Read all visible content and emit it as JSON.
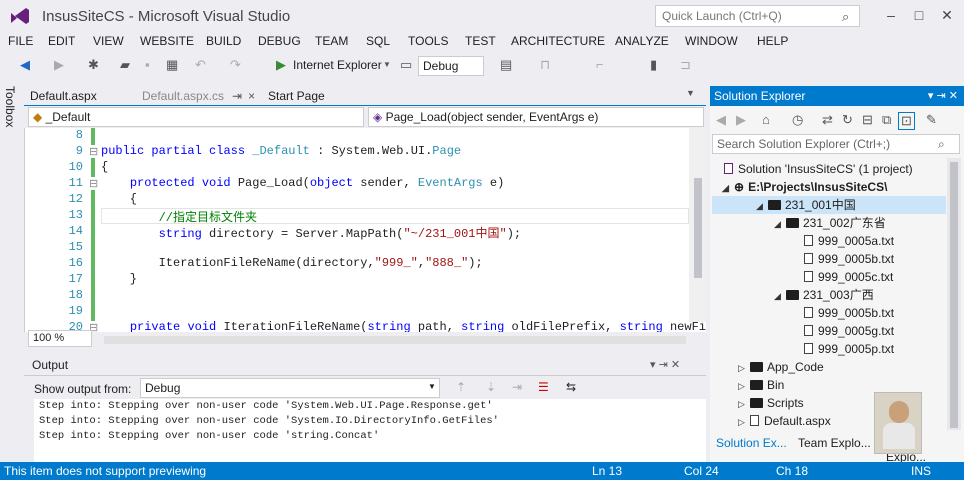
{
  "window": {
    "title": "InsusSiteCS - Microsoft Visual Studio",
    "quick_launch_placeholder": "Quick Launch (Ctrl+Q)"
  },
  "menu": [
    "FILE",
    "EDIT",
    "VIEW",
    "WEBSITE",
    "BUILD",
    "DEBUG",
    "TEAM",
    "SQL",
    "TOOLS",
    "TEST",
    "ARCHITECTURE",
    "ANALYZE",
    "WINDOW",
    "HELP"
  ],
  "toolbar": {
    "run_target": "Internet Explorer",
    "configuration": "Debug"
  },
  "side_tab": "Toolbox",
  "tabs": [
    {
      "label": "Default.aspx",
      "active": false
    },
    {
      "label": "Default.aspx.cs",
      "active": true
    },
    {
      "label": "Start Page",
      "active": false
    }
  ],
  "nav": {
    "class_combo": "_Default",
    "method_combo": "Page_Load(object sender, EventArgs e)"
  },
  "editor": {
    "zoom": "100 %",
    "lines": [
      {
        "n": "8",
        "t": ""
      },
      {
        "n": "9",
        "t": "public partial class _Default : System.Web.UI.Page"
      },
      {
        "n": "10",
        "t": "{"
      },
      {
        "n": "11",
        "t": "    protected void Page_Load(object sender, EventArgs e)"
      },
      {
        "n": "12",
        "t": "    {"
      },
      {
        "n": "13",
        "t": "        //指定目标文件夹"
      },
      {
        "n": "14",
        "t": "        string directory = Server.MapPath(\"~/231_001中国\");"
      },
      {
        "n": "15",
        "t": ""
      },
      {
        "n": "16",
        "t": "        IterationFileReName(directory,\"999_\",\"888_\");"
      },
      {
        "n": "17",
        "t": "    }"
      },
      {
        "n": "18",
        "t": ""
      },
      {
        "n": "19",
        "t": ""
      },
      {
        "n": "20",
        "t": "    private void IterationFileReName(string path, string oldFilePrefix, string newFi"
      }
    ]
  },
  "output": {
    "title": "Output",
    "show_from_label": "Show output from:",
    "show_from_value": "Debug",
    "lines": [
      "Step into: Stepping over non-user code 'System.Web.UI.Page.Response.get'",
      "Step into: Stepping over non-user code 'System.IO.DirectoryInfo.GetFiles'",
      "Step into: Stepping over non-user code 'string.Concat'"
    ]
  },
  "solution_explorer": {
    "title": "Solution Explorer",
    "search_placeholder": "Search Solution Explorer (Ctrl+;)",
    "solution": "Solution 'InsusSiteCS' (1 project)",
    "project": "E:\\Projects\\InsusSiteCS\\",
    "tree": [
      {
        "label": "231_001中国",
        "indent": 2,
        "kind": "folder",
        "expanded": true,
        "selected": true
      },
      {
        "label": "231_002广东省",
        "indent": 3,
        "kind": "folder",
        "expanded": true
      },
      {
        "label": "999_0005a.txt",
        "indent": 4,
        "kind": "file"
      },
      {
        "label": "999_0005b.txt",
        "indent": 4,
        "kind": "file"
      },
      {
        "label": "999_0005c.txt",
        "indent": 4,
        "kind": "file"
      },
      {
        "label": "231_003广西",
        "indent": 3,
        "kind": "folder",
        "expanded": true
      },
      {
        "label": "999_0005b.txt",
        "indent": 4,
        "kind": "file"
      },
      {
        "label": "999_0005g.txt",
        "indent": 4,
        "kind": "file"
      },
      {
        "label": "999_0005p.txt",
        "indent": 4,
        "kind": "file"
      },
      {
        "label": "App_Code",
        "indent": 1,
        "kind": "folder",
        "expanded": false
      },
      {
        "label": "Bin",
        "indent": 1,
        "kind": "folder",
        "expanded": false
      },
      {
        "label": "Scripts",
        "indent": 1,
        "kind": "folder",
        "expanded": false
      },
      {
        "label": "Default.aspx",
        "indent": 1,
        "kind": "file",
        "expanded": false
      }
    ],
    "bottom_tabs": [
      "Solution Ex...",
      "Team Explo...",
      "Server Explo..."
    ]
  },
  "status": {
    "message": "This item does not support previewing",
    "ln": "Ln 13",
    "col": "Col 24",
    "ch": "Ch 18",
    "mode": "INS"
  },
  "colors": {
    "accent": "#007acc"
  }
}
